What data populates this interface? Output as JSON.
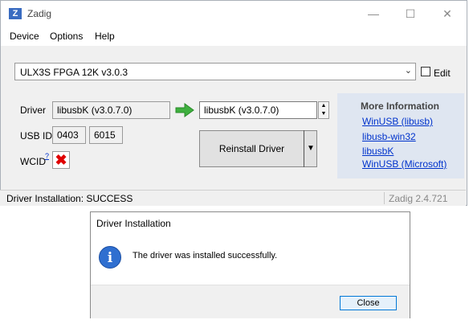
{
  "window": {
    "title": "Zadig",
    "icon_text": "Z",
    "controls": {
      "minimize": "—",
      "maximize": "☐",
      "close": "✕"
    }
  },
  "menu": [
    "Device",
    "Options",
    "Help"
  ],
  "device": {
    "selected": "ULX3S FPGA 12K v3.0.3",
    "edit_label": "Edit"
  },
  "driver": {
    "label": "Driver",
    "current": "libusbK (v3.0.7.0)",
    "target": "libusbK (v3.0.7.0)"
  },
  "usb_id": {
    "label": "USB ID",
    "vid": "0403",
    "pid": "6015"
  },
  "wcid": {
    "label": "WCID",
    "help_sup": "?",
    "status_glyph": "✖"
  },
  "reinstall_button": "Reinstall Driver",
  "more_info": {
    "title": "More Information",
    "links": [
      "WinUSB (libusb)",
      "libusb-win32",
      "libusbK",
      "WinUSB (Microsoft)"
    ]
  },
  "status": {
    "text": "Driver Installation: SUCCESS",
    "version": "Zadig 2.4.721"
  },
  "dialog": {
    "title": "Driver Installation",
    "message": "The driver was installed successfully.",
    "icon_glyph": "i",
    "close_label": "Close"
  },
  "colors": {
    "link": "#0033cc",
    "info_panel": "#dfe6f1",
    "error_x": "#e00000",
    "arrow": "#3fb03f"
  }
}
